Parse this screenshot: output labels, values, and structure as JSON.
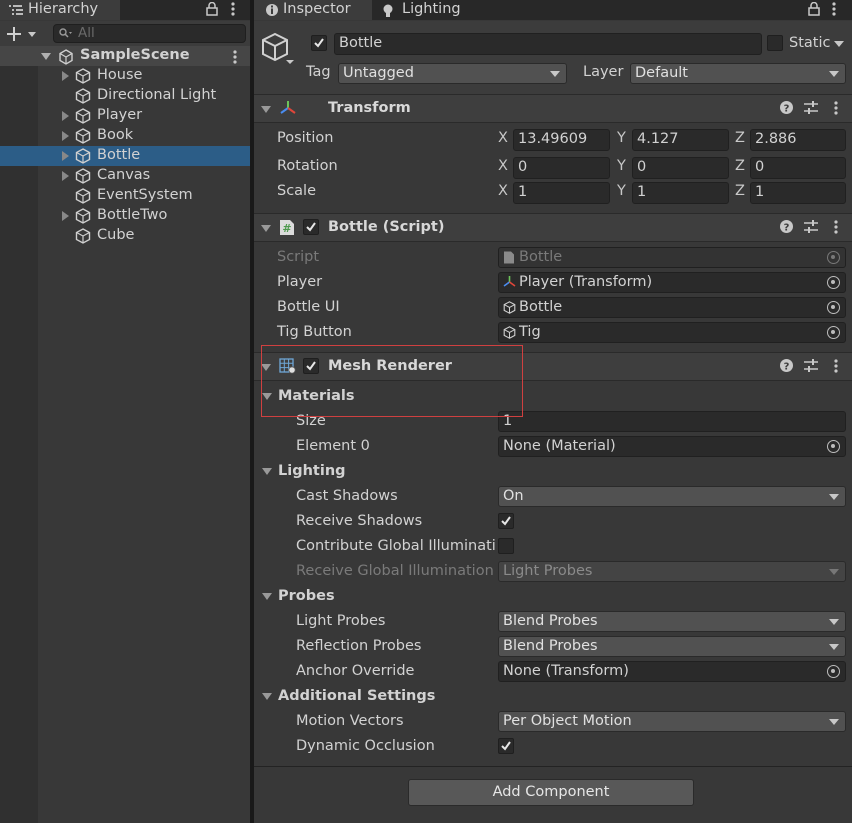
{
  "hierarchy": {
    "tab": "Hierarchy",
    "search_placeholder": "All",
    "scene": "SampleScene",
    "items": [
      {
        "label": "House",
        "has_children": true,
        "selected": false
      },
      {
        "label": "Directional Light",
        "has_children": false,
        "selected": false
      },
      {
        "label": "Player",
        "has_children": true,
        "selected": false
      },
      {
        "label": "Book",
        "has_children": true,
        "selected": false
      },
      {
        "label": "Bottle",
        "has_children": true,
        "selected": true
      },
      {
        "label": "Canvas",
        "has_children": true,
        "selected": false
      },
      {
        "label": "EventSystem",
        "has_children": false,
        "selected": false
      },
      {
        "label": "BottleTwo",
        "has_children": true,
        "selected": false
      },
      {
        "label": "Cube",
        "has_children": false,
        "selected": false
      }
    ]
  },
  "tabs": {
    "inspector": "Inspector",
    "lighting": "Lighting"
  },
  "object": {
    "name": "Bottle",
    "static_label": "Static",
    "tag_label": "Tag",
    "tag_value": "Untagged",
    "layer_label": "Layer",
    "layer_value": "Default"
  },
  "transform": {
    "title": "Transform",
    "rows": [
      {
        "label": "Position",
        "x": "13.49609",
        "y": "4.127",
        "z": "2.886"
      },
      {
        "label": "Rotation",
        "x": "0",
        "y": "0",
        "z": "0"
      },
      {
        "label": "Scale",
        "x": "1",
        "y": "1",
        "z": "1"
      }
    ],
    "axis": {
      "x": "X",
      "y": "Y",
      "z": "Z"
    }
  },
  "script_component": {
    "title": "Bottle (Script)",
    "rows": [
      {
        "label": "Script",
        "value": "Bottle",
        "icon": "script-icon",
        "disabled": true
      },
      {
        "label": "Player",
        "value": "Player (Transform)",
        "icon": "transform-icon"
      },
      {
        "label": "Bottle UI",
        "value": "Bottle",
        "icon": "gameobject-icon"
      },
      {
        "label": "Tig Button",
        "value": "Tig",
        "icon": "gameobject-icon"
      }
    ]
  },
  "mesh_renderer": {
    "title": "Mesh Renderer",
    "materials": {
      "title": "Materials",
      "size_label": "Size",
      "size_value": "1",
      "element0_label": "Element 0",
      "element0_value": "None (Material)"
    },
    "lighting": {
      "title": "Lighting",
      "cast_shadows_label": "Cast Shadows",
      "cast_shadows_value": "On",
      "receive_shadows_label": "Receive Shadows",
      "receive_shadows_checked": true,
      "contribute_gi_label": "Contribute Global Illuminatic",
      "contribute_gi_checked": false,
      "receive_gi_label": "Receive Global Illumination",
      "receive_gi_value": "Light Probes"
    },
    "probes": {
      "title": "Probes",
      "light_probes_label": "Light Probes",
      "light_probes_value": "Blend Probes",
      "reflection_probes_label": "Reflection Probes",
      "reflection_probes_value": "Blend Probes",
      "anchor_override_label": "Anchor Override",
      "anchor_override_value": "None (Transform)"
    },
    "additional": {
      "title": "Additional Settings",
      "motion_vectors_label": "Motion Vectors",
      "motion_vectors_value": "Per Object Motion",
      "dynamic_occlusion_label": "Dynamic Occlusion",
      "dynamic_occlusion_checked": true
    }
  },
  "add_component_label": "Add Component",
  "colors": {
    "selection": "#2c5d87",
    "panel": "#383838",
    "highlight_box": "#d04040"
  }
}
